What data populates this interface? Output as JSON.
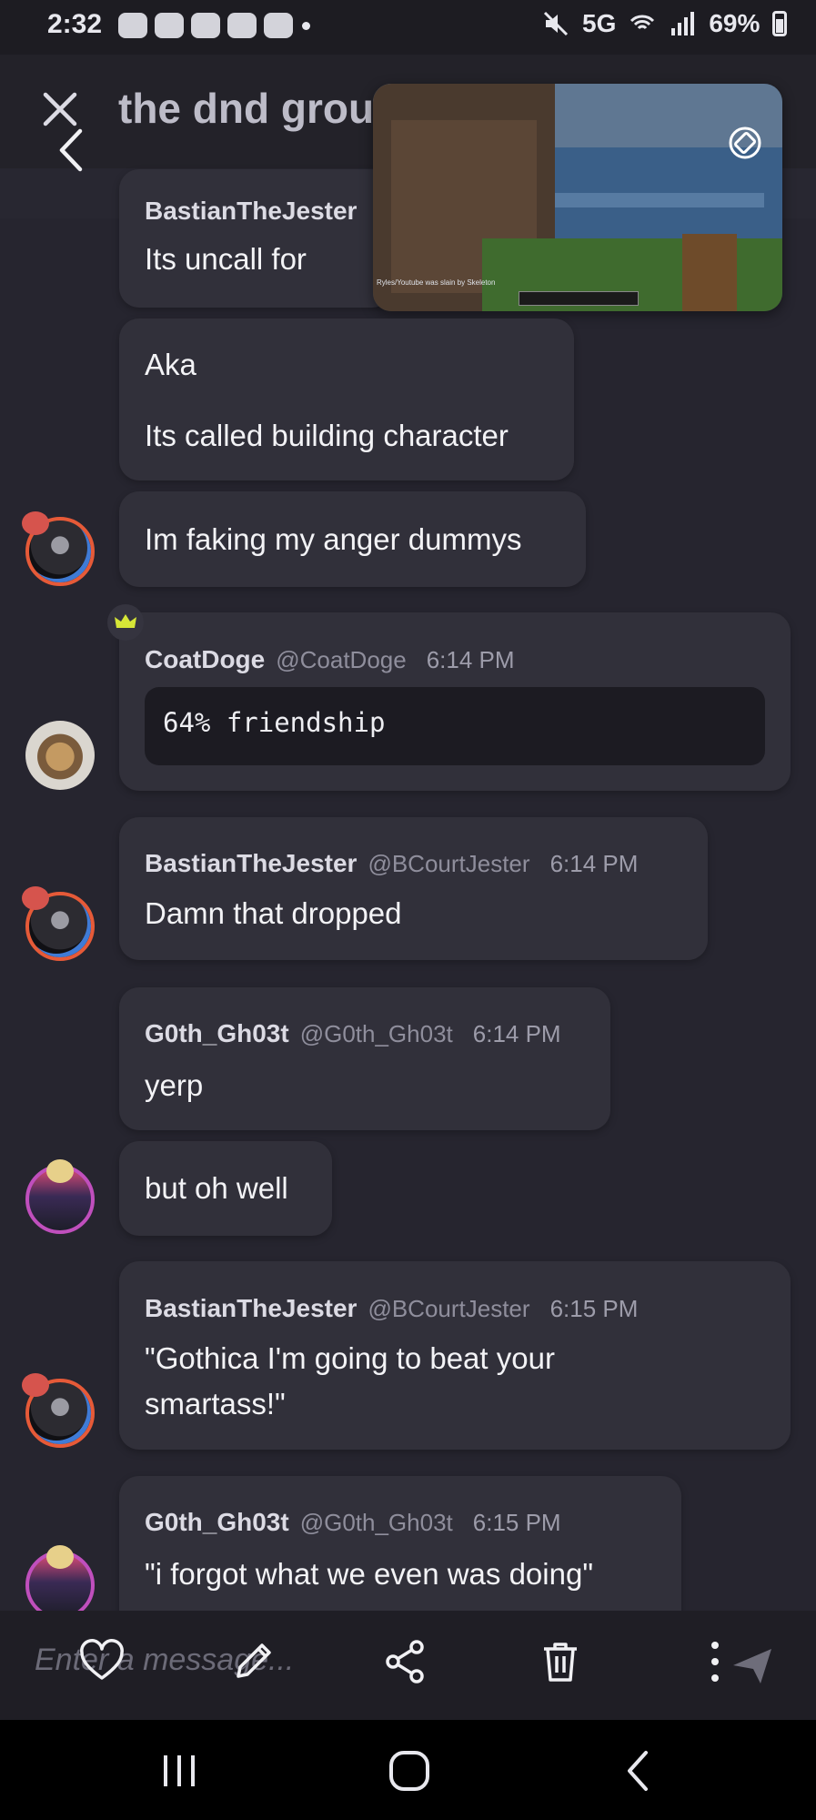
{
  "status_bar": {
    "time": "2:32",
    "notification_icons": [
      "chat-icon",
      "chat-icon",
      "chat-icon",
      "chat-icon",
      "chat-icon"
    ],
    "network": "5G",
    "battery": "69%"
  },
  "header": {
    "title": "the dnd group",
    "close_icon": "close-icon",
    "back_icon": "chevron-left-icon"
  },
  "pip": {
    "caption": "Ryles/Youtube was slain by Skeleton",
    "rotate_icon": "rotate-icon"
  },
  "messages": [
    {
      "name": "BastianTheJester",
      "text": "Its uncall for"
    },
    {
      "lines": [
        "Aka",
        "Its called building character"
      ]
    },
    {
      "text": "Im faking my anger dummys"
    },
    {
      "name": "CoatDoge",
      "handle": "@CoatDoge",
      "time": "6:14 PM",
      "code": "64% friendship"
    },
    {
      "name": "BastianTheJester",
      "handle": "@BCourtJester",
      "time": "6:14 PM",
      "text": "Damn that dropped"
    },
    {
      "name": "G0th_Gh03t",
      "handle": "@G0th_Gh03t",
      "time": "6:14 PM",
      "text": "yerp"
    },
    {
      "text": "but oh well"
    },
    {
      "name": "BastianTheJester",
      "handle": "@BCourtJester",
      "time": "6:15 PM",
      "lines": [
        "\"Gothica I'm going to beat your",
        "smartass!\""
      ]
    },
    {
      "name": "G0th_Gh03t",
      "handle": "@G0th_Gh03t",
      "time": "6:15 PM",
      "text": "\"i forgot what we even was doing\""
    }
  ],
  "composer": {
    "placeholder": "Enter a message...",
    "tools": [
      "heart-icon",
      "pencil-icon",
      "share-icon",
      "trash-icon",
      "more-vertical-icon",
      "send-icon"
    ]
  },
  "nav": [
    "recents-icon",
    "home-icon",
    "back-icon"
  ],
  "colors": {
    "background": "#26252f",
    "bubble": "#31303a",
    "code_block": "#1c1b22",
    "crown": "#d6e637"
  }
}
